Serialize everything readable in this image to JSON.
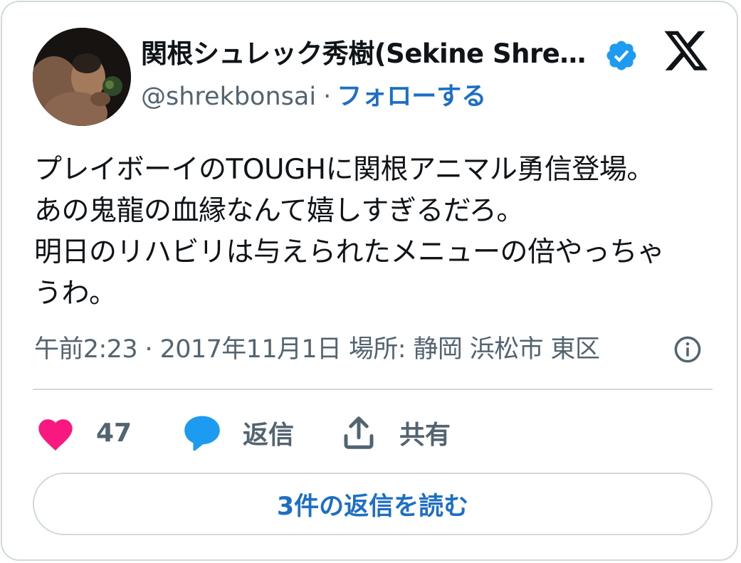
{
  "author": {
    "display_name": "関根シュレック秀樹(Sekine Shre…",
    "handle": "@shrekbonsai",
    "separator": "·",
    "follow_label": "フォローする",
    "verified": true
  },
  "tweet": {
    "lines": [
      "プレイボーイのTOUGHに関根アニマル勇信登場。",
      "あの鬼龍の血縁なんて嬉しすぎるだろ。",
      "明日のリハビリは与えられたメニューの倍やっちゃ",
      "うわ。"
    ],
    "meta": "午前2:23 · 2017年11月1日 場所: 静岡 浜松市 東区"
  },
  "actions": {
    "like_count": "47",
    "reply_label": "返信",
    "share_label": "共有"
  },
  "read_replies_label": "3件の返信を読む",
  "colors": {
    "like": "#f91880",
    "reply": "#1d9bf0",
    "link": "#1d6fc4",
    "muted": "#536471",
    "border": "#cfd9de"
  },
  "icons": [
    "avatar",
    "verified-badge-icon",
    "x-logo-icon",
    "info-icon",
    "heart-icon",
    "speech-bubble-icon",
    "share-icon"
  ]
}
